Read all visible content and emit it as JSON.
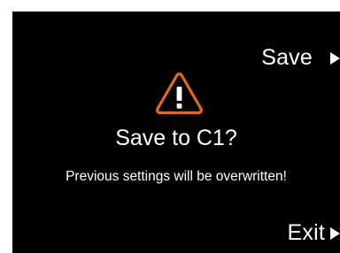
{
  "dialog": {
    "title": "Save to C1?",
    "message": "Previous settings will be overwritten!",
    "warning_icon": "warning-triangle-icon",
    "warning_color": "#e06a1e"
  },
  "soft_keys": {
    "save_label": "Save",
    "exit_label": "Exit",
    "arrow_icon": "triangle-right-icon"
  },
  "colors": {
    "background": "#000000",
    "text": "#ffffff",
    "accent": "#e06a1e"
  }
}
